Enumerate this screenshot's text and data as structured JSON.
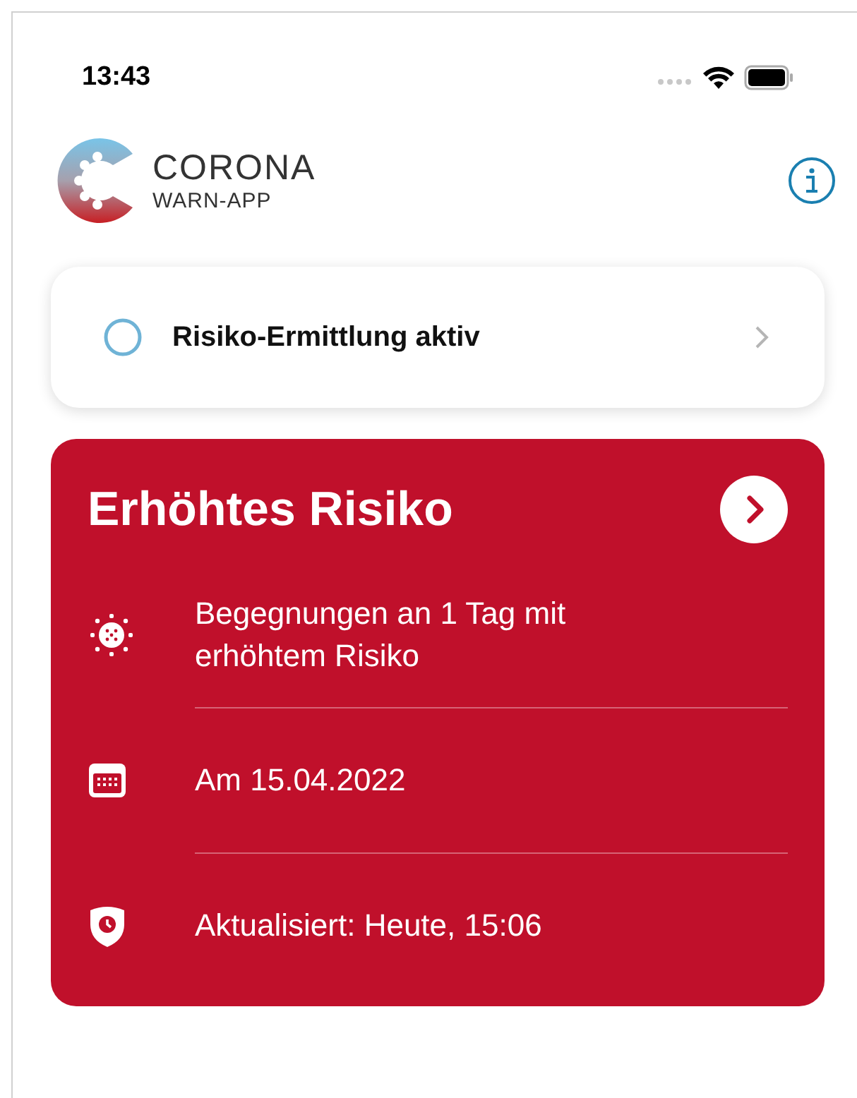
{
  "status_bar": {
    "time": "13:43"
  },
  "header": {
    "logo_title": "CORONA",
    "logo_subtitle": "WARN-APP"
  },
  "status_card": {
    "label": "Risiko-Ermittlung aktiv"
  },
  "risk_card": {
    "title": "Erhöhtes Risiko",
    "items": [
      {
        "kind": "encounters",
        "text": "Begegnungen an 1 Tag mit erhöhtem Risiko"
      },
      {
        "kind": "date",
        "text": "Am 15.04.2022"
      },
      {
        "kind": "updated",
        "text": "Aktualisiert: Heute, 15:06"
      }
    ]
  }
}
